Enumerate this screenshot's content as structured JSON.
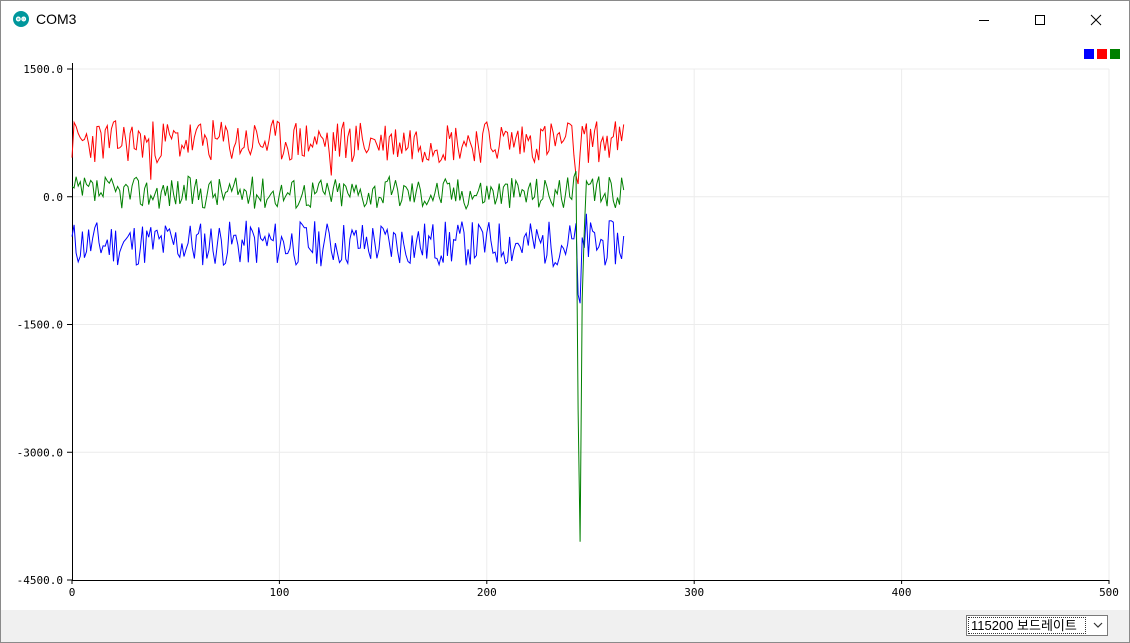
{
  "window": {
    "title": "COM3",
    "app_icon": "arduino-icon"
  },
  "controls": {
    "minimize": "minimize-icon",
    "maximize": "maximize-icon",
    "close": "close-icon"
  },
  "baud": {
    "selected": "115200 보드레이트",
    "arrow": "chevron-down-icon"
  },
  "colors": {
    "series1": "#0000ff",
    "series2": "#ff0000",
    "series3": "#008000",
    "grid": "#ececec",
    "axis": "#000000"
  },
  "chart_data": {
    "type": "line",
    "title": "",
    "xlabel": "",
    "ylabel": "",
    "xlim": [
      0,
      500
    ],
    "ylim": [
      -4500,
      1500
    ],
    "x_ticks": [
      "0",
      "100",
      "200",
      "300",
      "400",
      "500"
    ],
    "y_ticks": [
      "1500.0",
      "0.0",
      "-1500.0",
      "-3000.0",
      "-4500.0"
    ],
    "y_tick_values": [
      1500,
      0,
      -1500,
      -3000,
      -4500
    ],
    "x_tick_values": [
      0,
      100,
      200,
      300,
      400,
      500
    ],
    "grid": true,
    "legend": "top-right",
    "series": [
      {
        "color": "#0000ff",
        "n": 267,
        "base": -550,
        "noise": 170,
        "seed": 11,
        "spikes": {
          "244": -1150,
          "245": -1250,
          "247": -600,
          "248": -200
        }
      },
      {
        "color": "#ff0000",
        "n": 267,
        "base": 650,
        "noise": 160,
        "seed": 23,
        "spikes": {
          "38": 200,
          "125": 250,
          "243": 250,
          "244": 150
        }
      },
      {
        "color": "#008000",
        "n": 267,
        "base": 50,
        "noise": 120,
        "seed": 37,
        "spikes": {
          "243": 300,
          "244": -2500,
          "245": -4050,
          "246": -1200,
          "247": -400
        }
      }
    ]
  }
}
